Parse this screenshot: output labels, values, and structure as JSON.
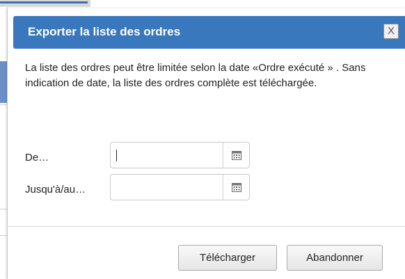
{
  "dialog": {
    "title": "Exporter la liste des ordres",
    "close_label": "X",
    "description": "La liste des ordres peut être limitée selon la date «Ordre exécuté » . Sans indication de date, la liste des ordres complète est téléchargée.",
    "from_label": "De…",
    "from_value": "",
    "to_label": "Jusqu'à/au…",
    "to_value": "",
    "download_label": "Télécharger",
    "cancel_label": "Abandonner"
  },
  "icons": {
    "calendar": "calendar-icon",
    "close": "close-icon"
  },
  "colors": {
    "titlebar": "#3a78be",
    "title_text": "#ffffff"
  }
}
